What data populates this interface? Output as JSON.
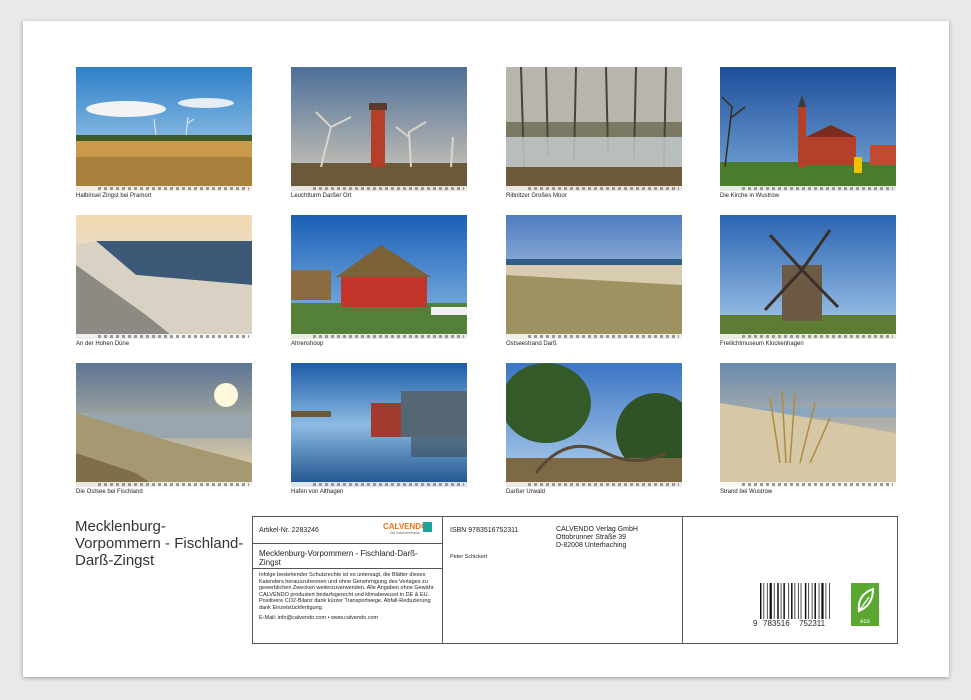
{
  "calendar": {
    "title": "Mecklenburg-Vorpommern - Fischland-Darß-Zingst",
    "thumbnails": [
      {
        "caption": "Halbinsel Zingst bei Pramort"
      },
      {
        "caption": "Leuchtturm Darßer Ort"
      },
      {
        "caption": "Ribnitzer Großes Moor"
      },
      {
        "caption": "Die Kirche in Wustrow"
      },
      {
        "caption": "An der Hohen Düne"
      },
      {
        "caption": "Ahrenshoop"
      },
      {
        "caption": "Ostseestrand Darß"
      },
      {
        "caption": "Freilichtmuseum Klockenhagen"
      },
      {
        "caption": "Die Ostsee bei Fischland"
      },
      {
        "caption": "Hafen von Althagen"
      },
      {
        "caption": "Darßer Urwald"
      },
      {
        "caption": "Strand bei Wustrow"
      }
    ]
  },
  "info": {
    "article": "Artikel-Nr. 2283246",
    "brand": "CALVENDO",
    "brand_sub": "Die Kalendermarke",
    "product_title": "Mecklenburg-Vorpommern - Fischland-Darß-Zingst",
    "legal": "Infolge bestehender Schutzrechte ist es untersagt, die Blätter dieses Kalenders herauszutrennen und ohne Genehmigung des Verlages zu gewerblichen Zwecken weiterzuverwenden. Alle Angaben ohne Gewähr. CALVENDO produziert bedarfsgerecht und klimabewusst in DE & EU. Positivere CO2-Bilanz dank kürzer Transportwege. Abfall-Reduzierung dank Einzelstückfertigung.",
    "email": "E-Mail: info@calvendo.com • www.calvendo.com",
    "isbn": "ISBN 9783516752311",
    "author": "Peter Schickert",
    "publisher_lines": [
      "CALVENDO Verlag GmbH",
      "Ottobrunner Straße 39",
      "D-82008 Unterhaching"
    ],
    "barcode_digits": [
      "9",
      "783516",
      "752311"
    ],
    "eco_label": "eco"
  },
  "colors": {
    "brand_orange": "#e8731c",
    "brand_teal": "#1fa39a",
    "eco_green": "#5aa832"
  }
}
